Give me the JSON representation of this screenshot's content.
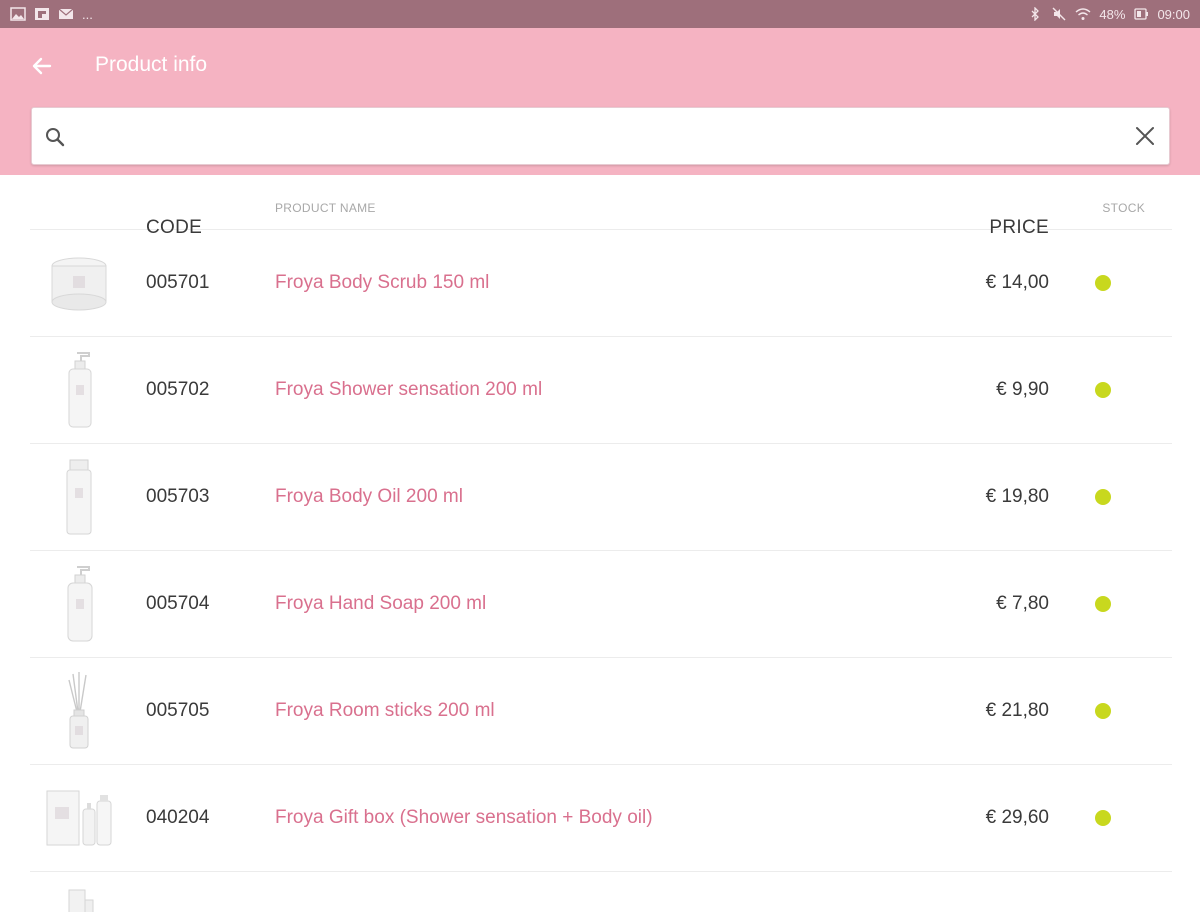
{
  "status_bar": {
    "left_more": "...",
    "battery": "48%",
    "time": "09:00"
  },
  "app_bar": {
    "title": "Product info"
  },
  "search": {
    "value": "",
    "placeholder": ""
  },
  "table": {
    "headers": {
      "code": "CODE",
      "name": "PRODUCT NAME",
      "price": "PRICE",
      "stock": "STOCK"
    },
    "rows": [
      {
        "code": "005701",
        "name": "Froya Body Scrub 150 ml",
        "price": "€ 14,00",
        "thumb": "jar"
      },
      {
        "code": "005702",
        "name": "Froya Shower sensation 200 ml",
        "price": "€ 9,90",
        "thumb": "pump"
      },
      {
        "code": "005703",
        "name": "Froya Body Oil 200 ml",
        "price": "€ 19,80",
        "thumb": "bottle"
      },
      {
        "code": "005704",
        "name": "Froya Hand Soap 200 ml",
        "price": "€ 7,80",
        "thumb": "pump"
      },
      {
        "code": "005705",
        "name": "Froya Room sticks 200 ml",
        "price": "€ 21,80",
        "thumb": "sticks"
      },
      {
        "code": "040204",
        "name": "Froya Gift box (Shower sensation + Body oil)",
        "price": "€ 29,60",
        "thumb": "giftbox"
      }
    ]
  },
  "colors": {
    "accent": "#d9708e",
    "app_bar": "#f5b3c2",
    "status_bar": "#9e6f7b",
    "in_stock": "#c8d81e"
  }
}
